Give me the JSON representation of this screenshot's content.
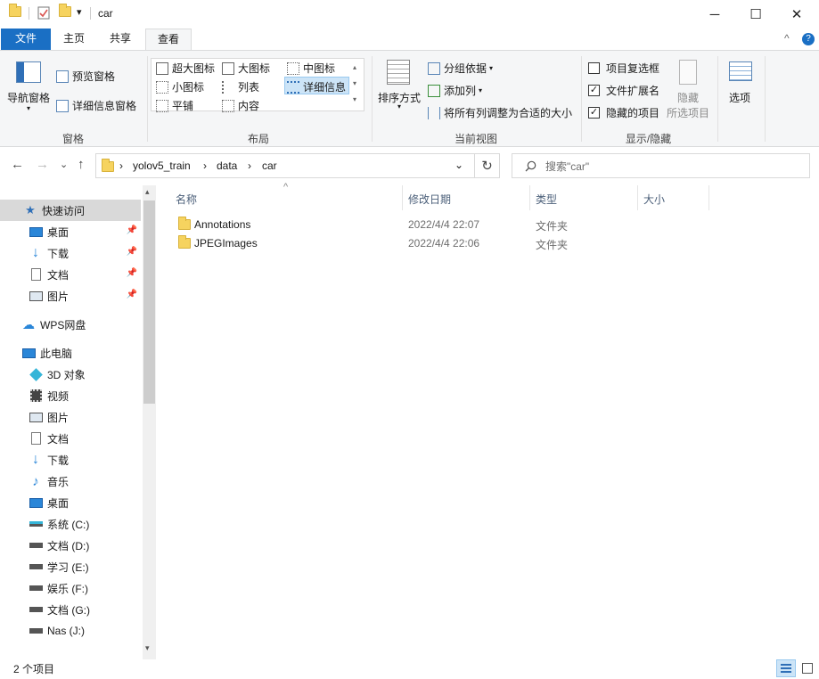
{
  "titlebar": {
    "title": "car",
    "minimize_glyph": "─",
    "maximize_glyph": "☐",
    "close_glyph": "✕",
    "dropdown_glyph": "▾"
  },
  "tabs": [
    {
      "label": "文件"
    },
    {
      "label": "主页"
    },
    {
      "label": "共享"
    },
    {
      "label": "查看"
    }
  ],
  "ribbon": {
    "collapse_glyph": "^",
    "help_glyph": "?",
    "panes": {
      "nav_pane": "导航窗格",
      "preview_pane": "预览窗格",
      "details_pane": "详细信息窗格",
      "group_label": "窗格"
    },
    "layout": {
      "options": [
        "超大图标",
        "大图标",
        "中图标",
        "小图标",
        "列表",
        "详细信息",
        "平铺",
        "内容"
      ],
      "selected": "详细信息",
      "group_label": "布局"
    },
    "current_view": {
      "sort_by": "排序方式",
      "group_by": "分组依据",
      "add_column": "添加列",
      "fit_columns": "将所有列调整为合适的大小",
      "group_label": "当前视图"
    },
    "show_hide": {
      "item_checkboxes": {
        "label": "项目复选框",
        "checked": false
      },
      "file_extensions": {
        "label": "文件扩展名",
        "checked": true
      },
      "hidden_items": {
        "label": "隐藏的项目",
        "checked": true
      },
      "hide_selected_line1": "隐藏",
      "hide_selected_line2": "所选项目",
      "options": "选项",
      "group_label": "显示/隐藏"
    }
  },
  "address": {
    "back_glyph": "←",
    "forward_glyph": "→",
    "recent_glyph": "⌄",
    "up_glyph": "↑",
    "breadcrumbs": [
      "yolov5_train",
      "data",
      "car"
    ],
    "separator": "›",
    "refresh_glyph": "↻",
    "search_placeholder": "搜索\"car\""
  },
  "sidebar": {
    "quick_access": "快速访问",
    "quick_items": [
      {
        "label": "桌面",
        "icon": "desktop-icon"
      },
      {
        "label": "下载",
        "icon": "download-icon"
      },
      {
        "label": "文档",
        "icon": "document-icon"
      },
      {
        "label": "图片",
        "icon": "pictures-icon"
      }
    ],
    "wps": "WPS网盘",
    "this_pc": "此电脑",
    "pc_items": [
      {
        "label": "3D 对象",
        "icon": "3d-objects-icon"
      },
      {
        "label": "视频",
        "icon": "video-icon"
      },
      {
        "label": "图片",
        "icon": "pictures-icon"
      },
      {
        "label": "文档",
        "icon": "document-icon"
      },
      {
        "label": "下载",
        "icon": "download-icon"
      },
      {
        "label": "音乐",
        "icon": "music-icon"
      },
      {
        "label": "桌面",
        "icon": "desktop-icon"
      },
      {
        "label": "系统 (C:)",
        "icon": "system-drive-icon"
      },
      {
        "label": "文档 (D:)",
        "icon": "drive-icon"
      },
      {
        "label": "学习 (E:)",
        "icon": "drive-icon"
      },
      {
        "label": "娱乐 (F:)",
        "icon": "drive-icon"
      },
      {
        "label": "文档 (G:)",
        "icon": "drive-icon"
      },
      {
        "label": "Nas (J:)",
        "icon": "drive-icon"
      }
    ]
  },
  "content": {
    "columns": [
      "名称",
      "修改日期",
      "类型",
      "大小"
    ],
    "sort_glyph": "^",
    "rows": [
      {
        "name": "Annotations",
        "date": "2022/4/4 22:07",
        "type": "文件夹"
      },
      {
        "name": "JPEGImages",
        "date": "2022/4/4 22:06",
        "type": "文件夹"
      }
    ]
  },
  "status": {
    "count": "2 个项目"
  },
  "colors": {
    "accent": "#1a6fc4",
    "selection": "#cce4f7",
    "folder": "#f6d35f"
  }
}
